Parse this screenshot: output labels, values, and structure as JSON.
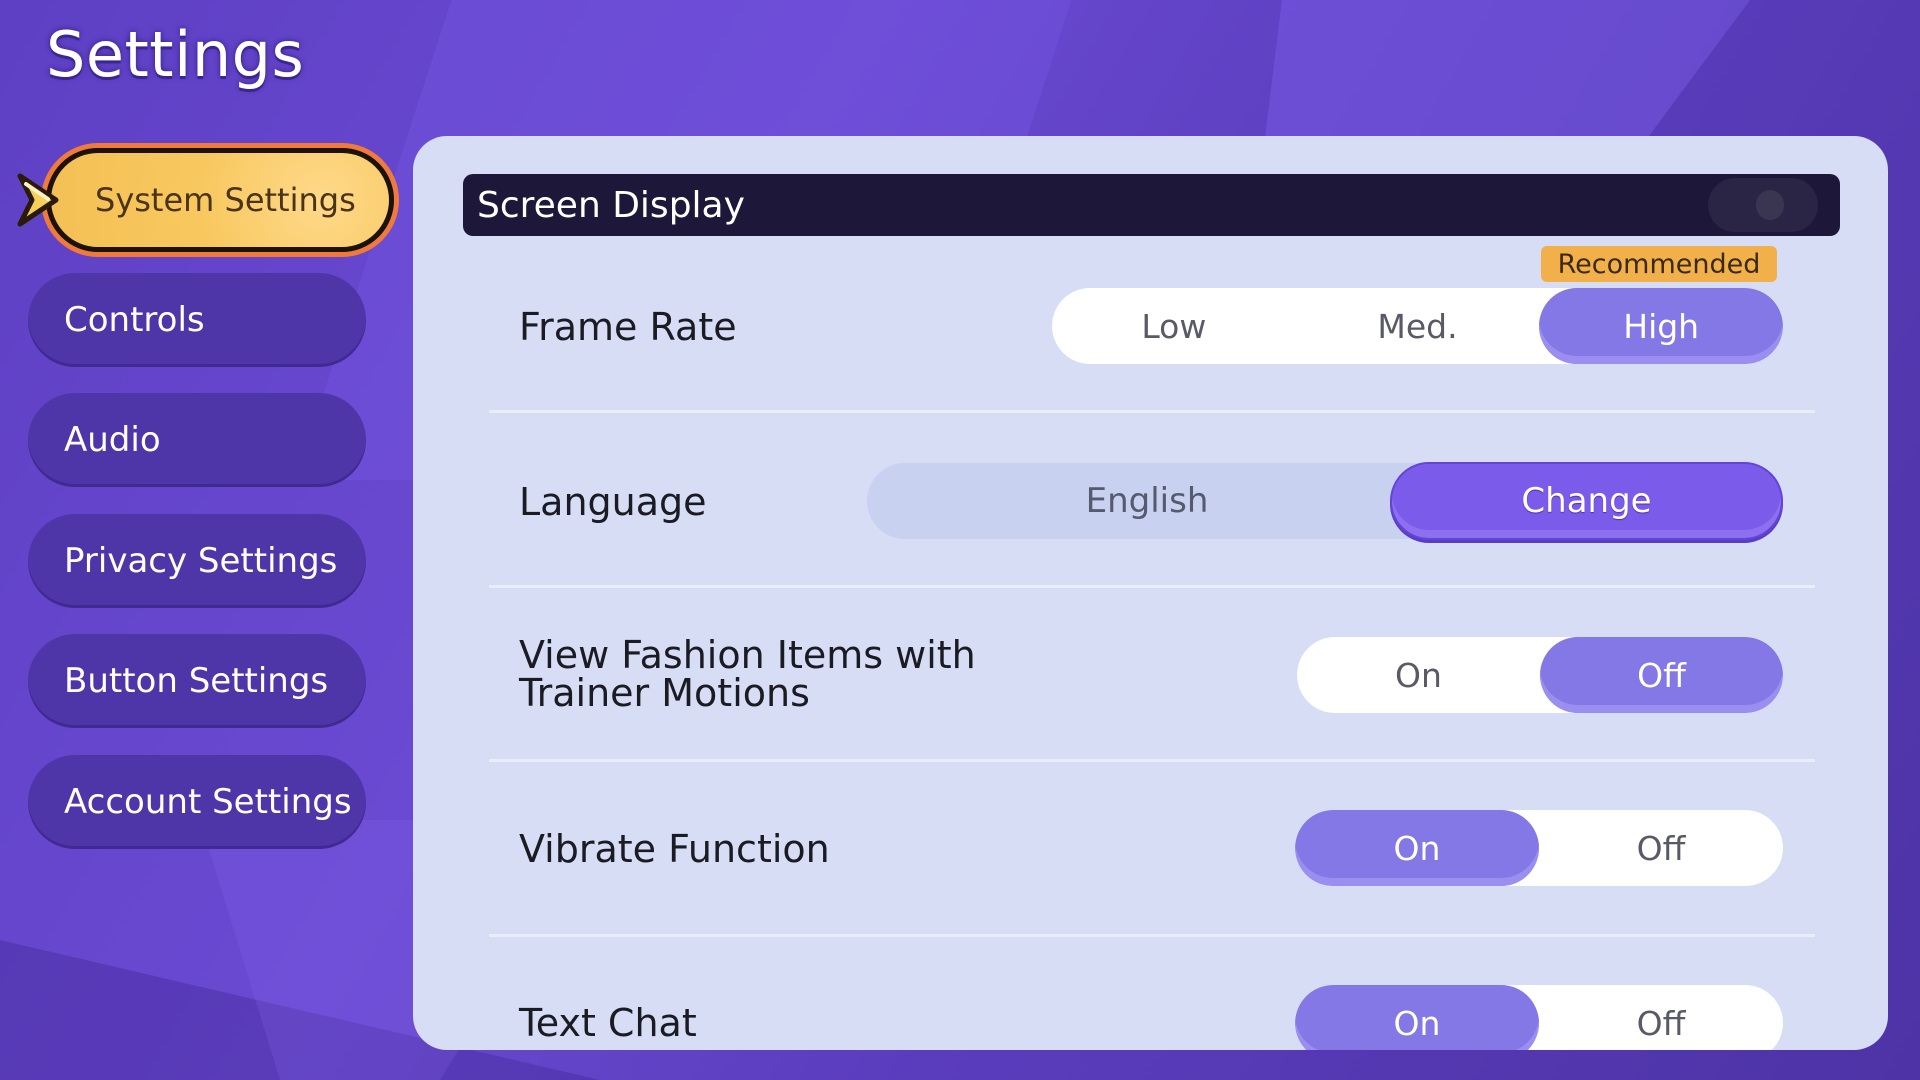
{
  "page": {
    "title": "Settings"
  },
  "sidebar": {
    "items": [
      {
        "label": "System Settings",
        "active": true
      },
      {
        "label": "Controls",
        "active": false
      },
      {
        "label": "Audio",
        "active": false
      },
      {
        "label": "Privacy Settings",
        "active": false
      },
      {
        "label": "Button Settings",
        "active": false
      },
      {
        "label": "Account Settings",
        "active": false
      }
    ]
  },
  "panel": {
    "section_title": "Screen Display",
    "recommended_badge": "Recommended",
    "settings": {
      "frame_rate": {
        "label": "Frame Rate",
        "options": [
          "Low",
          "Med.",
          "High"
        ],
        "selected": "High"
      },
      "language": {
        "label": "Language",
        "value": "English",
        "action_label": "Change"
      },
      "fashion": {
        "label_line1": "View Fashion Items with",
        "label_line2": "Trainer Motions",
        "options": [
          "On",
          "Off"
        ],
        "selected": "Off"
      },
      "vibrate": {
        "label": "Vibrate Function",
        "options": [
          "On",
          "Off"
        ],
        "selected": "On"
      },
      "text_chat": {
        "label": "Text Chat",
        "options": [
          "On",
          "Off"
        ],
        "selected": "On"
      }
    }
  },
  "colors": {
    "accent_purple": "#8477e6",
    "change_button": "#7b5bea",
    "active_tab": "#f8c85e",
    "badge": "#f2b04a",
    "header_bar": "#1d1839"
  }
}
